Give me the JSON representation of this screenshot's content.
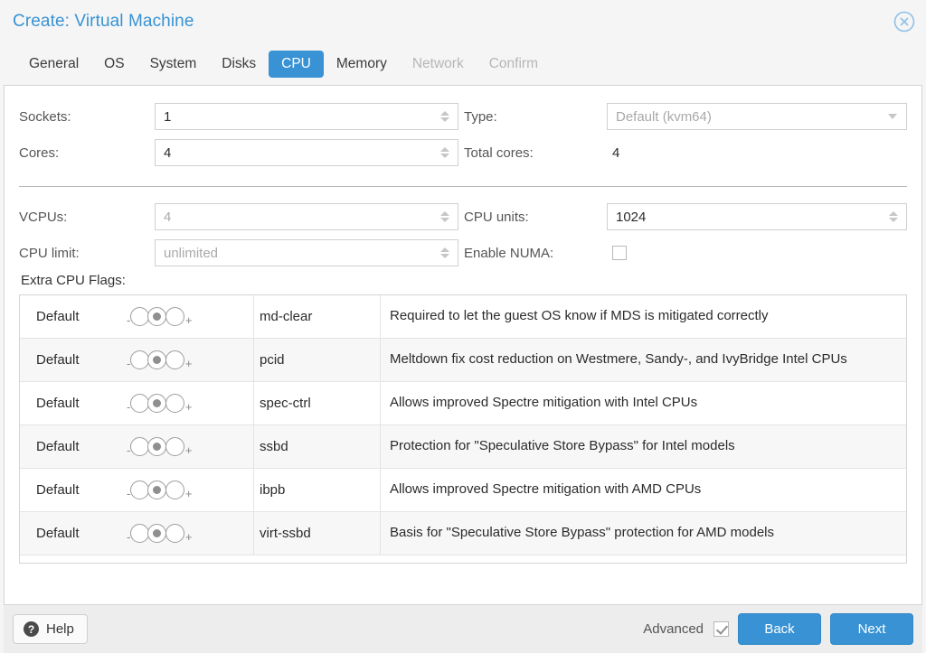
{
  "dialog": {
    "title": "Create: Virtual Machine",
    "close_icon": "close-circle-icon"
  },
  "tabs": [
    {
      "label": "General",
      "state": "enabled"
    },
    {
      "label": "OS",
      "state": "enabled"
    },
    {
      "label": "System",
      "state": "enabled"
    },
    {
      "label": "Disks",
      "state": "enabled"
    },
    {
      "label": "CPU",
      "state": "active"
    },
    {
      "label": "Memory",
      "state": "enabled"
    },
    {
      "label": "Network",
      "state": "disabled"
    },
    {
      "label": "Confirm",
      "state": "disabled"
    }
  ],
  "form": {
    "sockets": {
      "label": "Sockets:",
      "value": "1"
    },
    "cores": {
      "label": "Cores:",
      "value": "4"
    },
    "type": {
      "label": "Type:",
      "value": "Default (kvm64)"
    },
    "total_cores": {
      "label": "Total cores:",
      "value": "4"
    },
    "vcpus": {
      "label": "VCPUs:",
      "value": "4"
    },
    "cpu_limit": {
      "label": "CPU limit:",
      "value": "unlimited"
    },
    "cpu_units": {
      "label": "CPU units:",
      "value": "1024"
    },
    "enable_numa": {
      "label": "Enable NUMA:",
      "checked": false
    }
  },
  "extra_cpu_flags": {
    "label": "Extra CPU Flags:",
    "state_label": "Default",
    "minus": "-",
    "plus": "+",
    "rows": [
      {
        "state": "Default",
        "name": "md-clear",
        "description": "Required to let the guest OS know if MDS is mitigated correctly"
      },
      {
        "state": "Default",
        "name": "pcid",
        "description": "Meltdown fix cost reduction on Westmere, Sandy-, and IvyBridge Intel CPUs"
      },
      {
        "state": "Default",
        "name": "spec-ctrl",
        "description": "Allows improved Spectre mitigation with Intel CPUs"
      },
      {
        "state": "Default",
        "name": "ssbd",
        "description": "Protection for \"Speculative Store Bypass\" for Intel models"
      },
      {
        "state": "Default",
        "name": "ibpb",
        "description": "Allows improved Spectre mitigation with AMD CPUs"
      },
      {
        "state": "Default",
        "name": "virt-ssbd",
        "description": "Basis for \"Speculative Store Bypass\" protection for AMD models"
      }
    ]
  },
  "footer": {
    "help_label": "Help",
    "help_icon": "question-mark-icon",
    "advanced_label": "Advanced",
    "advanced_checked": true,
    "back_label": "Back",
    "next_label": "Next"
  },
  "colors": {
    "accent": "#3892d4",
    "title": "#3892d4",
    "panel_bg": "#ffffff",
    "window_bg": "#f5f5f5",
    "footer_bg": "#ededed",
    "row_alt": "#f7f7f7"
  }
}
